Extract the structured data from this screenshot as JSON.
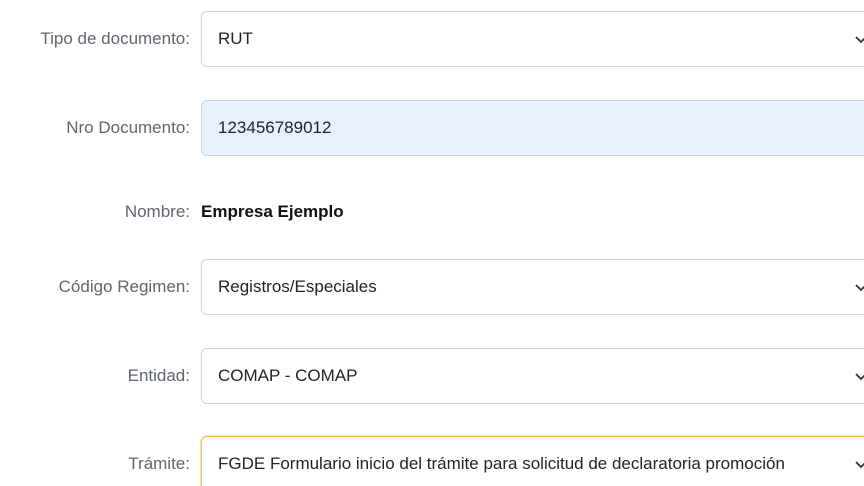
{
  "form": {
    "tipo_documento": {
      "label": "Tipo de documento:",
      "value": "RUT",
      "icon": "chevron-down-icon"
    },
    "nro_documento": {
      "label": "Nro Documento:",
      "value": "123456789012"
    },
    "nombre": {
      "label": "Nombre:",
      "value": "Empresa Ejemplo"
    },
    "codigo_regimen": {
      "label": "Código Regimen:",
      "value": "Registros/Especiales",
      "icon": "chevron-down-icon"
    },
    "entidad": {
      "label": "Entidad:",
      "value": "COMAP - COMAP",
      "icon": "chevron-down-icon"
    },
    "tramite": {
      "label": "Trámite:",
      "value": "FGDE Formulario inicio del trámite para solicitud de declaratoria promoción",
      "icon": "chevron-down-icon"
    }
  },
  "colors": {
    "label": "#5f6670",
    "filled_input_bg": "#e8f0fe",
    "focus_border": "#f5c04e",
    "border": "#d3d7dc"
  }
}
